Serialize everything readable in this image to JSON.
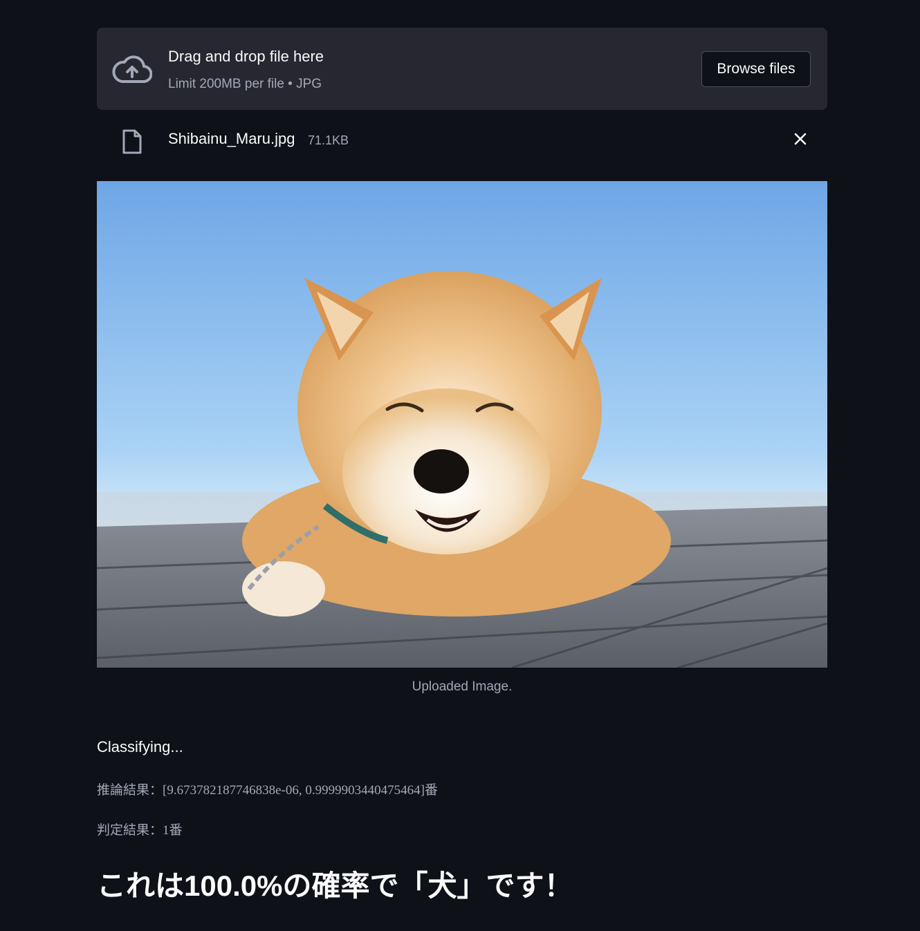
{
  "uploader": {
    "title": "Drag and drop file here",
    "limit": "Limit 200MB per file • JPG",
    "browse_label": "Browse files"
  },
  "file": {
    "name": "Shibainu_Maru.jpg",
    "size": "71.1KB"
  },
  "image": {
    "caption": "Uploaded Image."
  },
  "output": {
    "status": "Classifying...",
    "inference": "推論結果：[9.673782187746838e-06, 0.9999903440475464]番",
    "judgement": "判定結果：1番",
    "result": "これは100.0%の確率で「犬」です！"
  },
  "colors": {
    "background": "#0e1117",
    "dropzone": "#262730",
    "text_primary": "#fafafa",
    "text_secondary": "#a3a8b8"
  }
}
